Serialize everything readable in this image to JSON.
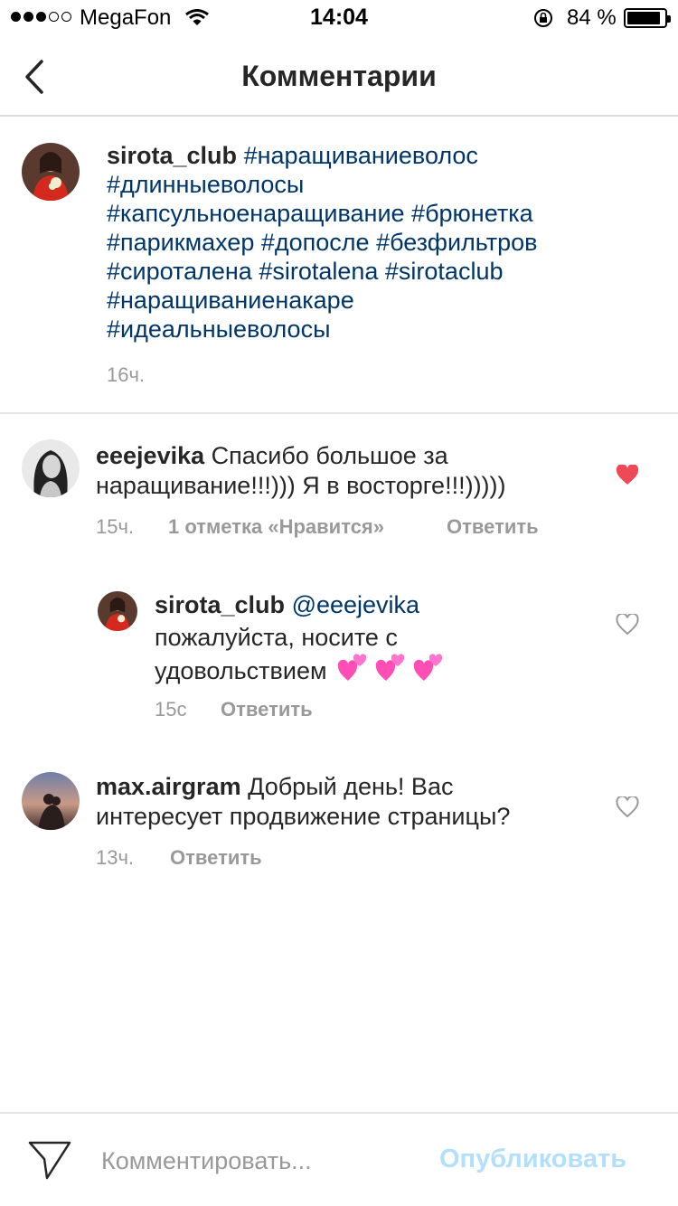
{
  "status_bar": {
    "carrier": "MegaFon",
    "time": "14:04",
    "battery": "84 %",
    "signal_bars_filled": 3,
    "signal_bars_total": 5,
    "battery_level": 0.84
  },
  "nav": {
    "title": "Комментарии",
    "back_icon": "chevron-left-icon"
  },
  "caption": {
    "username": "sirota_club",
    "lines": [
      "#наращиваниеволос",
      "#длинныеволосы",
      "#капсульноенаращивание #брюнетка",
      "#парикмахер #допосле #безфильтров",
      "#сироталена #sirotalena #sirotaclub",
      "#наращиваниенакаре",
      "#идеальныеволосы"
    ],
    "time": "16ч."
  },
  "comments": [
    {
      "username": "eeejevika",
      "text_line1": "Спасибо большое за",
      "text_line2": "наращивание!!!))) Я в восторге!!!)))))",
      "time": "15ч.",
      "likes": "1 отметка «Нравится»",
      "reply": "Ответить",
      "liked": true
    },
    {
      "username": "sirota_club",
      "mention": "@eeejevika",
      "text_line1": "пожалуйста, носите с",
      "text_line2": "удовольствием",
      "emoji": "revolving-hearts-icon",
      "time": "15с",
      "reply": "Ответить",
      "liked": false
    },
    {
      "username": "max.airgram",
      "text_line1": "Добрый день! Вас",
      "text_line2": "интересует продвижение страницы?",
      "time": "13ч.",
      "reply": "Ответить",
      "liked": false
    }
  ],
  "composer": {
    "placeholder": "Комментировать...",
    "publish_label": "Опубликовать"
  },
  "colors": {
    "hashtag": "#003569",
    "muted": "#999999",
    "liked_heart": "#ed4956",
    "publish_disabled": "#b2dffc"
  }
}
